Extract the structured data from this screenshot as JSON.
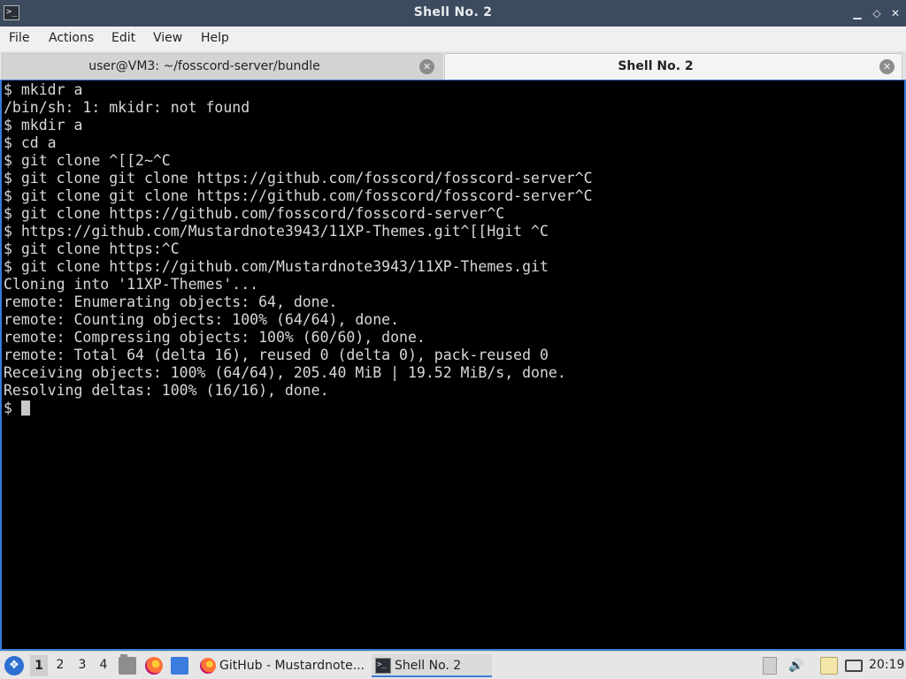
{
  "window": {
    "title": "Shell No. 2",
    "icon": "terminal-icon",
    "controls": {
      "minimize_glyph": "▁",
      "maximize_glyph": "◇",
      "close_glyph": "✕"
    }
  },
  "menu": {
    "items": [
      "File",
      "Actions",
      "Edit",
      "View",
      "Help"
    ]
  },
  "tabs": [
    {
      "label": "user@VM3: ~/fosscord-server/bundle",
      "active": false,
      "close_glyph": "✕"
    },
    {
      "label": "Shell No. 2",
      "active": true,
      "close_glyph": "✕"
    }
  ],
  "terminal": {
    "lines": [
      "$ mkidr a",
      "/bin/sh: 1: mkidr: not found",
      "$ mkdir a",
      "$ cd a",
      "$ git clone ^[[2~^C",
      "$ git clone git clone https://github.com/fosscord/fosscord-server^C",
      "$ git clone git clone https://github.com/fosscord/fosscord-server^C",
      "$ git clone https://github.com/fosscord/fosscord-server^C",
      "$ https://github.com/Mustardnote3943/11XP-Themes.git^[[Hgit ^C",
      "$ git clone https:^C",
      "$ git clone https://github.com/Mustardnote3943/11XP-Themes.git",
      "Cloning into '11XP-Themes'...",
      "remote: Enumerating objects: 64, done.",
      "remote: Counting objects: 100% (64/64), done.",
      "remote: Compressing objects: 100% (60/60), done.",
      "remote: Total 64 (delta 16), reused 0 (delta 0), pack-reused 0",
      "Receiving objects: 100% (64/64), 205.40 MiB | 19.52 MiB/s, done.",
      "Resolving deltas: 100% (16/16), done."
    ],
    "prompt": "$"
  },
  "taskbar": {
    "start_icon": "start-menu-icon",
    "start_glyph": "❖",
    "workspaces": [
      "1",
      "2",
      "3",
      "4"
    ],
    "active_workspace": "1",
    "launchers": [
      "file-manager-icon",
      "firefox-icon",
      "show-desktop-icon"
    ],
    "tasks": [
      {
        "label": "GitHub - Mustardnote...",
        "icon": "firefox-icon",
        "active": false
      },
      {
        "label": "Shell No. 2",
        "icon": "terminal-icon",
        "active": true
      }
    ],
    "tray": {
      "volume_glyph": "🔊",
      "clock": "20:19"
    }
  },
  "colors": {
    "titlebar": "#3c4b5e",
    "terminal_bg": "#000000",
    "terminal_fg": "#d8d8d8",
    "focus_border": "#3b7ad8",
    "taskbar": "#e6e6e6"
  }
}
